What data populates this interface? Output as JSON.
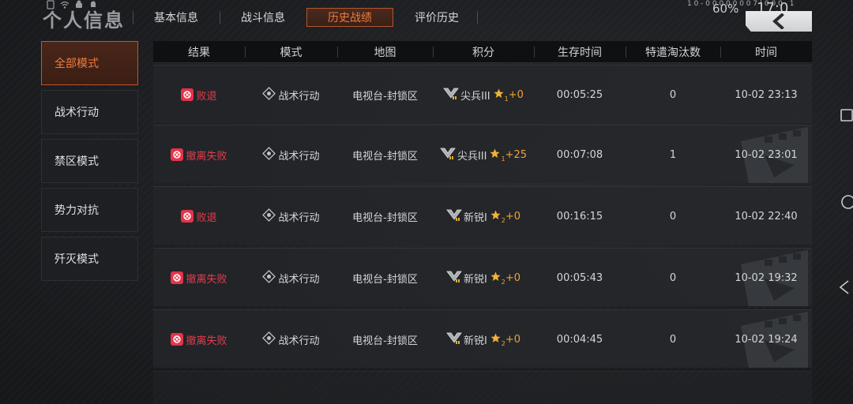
{
  "header": {
    "page_title": "个人信息",
    "tabs": [
      {
        "label": "基本信息",
        "active": false
      },
      {
        "label": "战斗信息",
        "active": false
      },
      {
        "label": "历史战绩",
        "active": true
      },
      {
        "label": "评价历史",
        "active": false
      }
    ],
    "status_text": "1 0 - 0 0 0 0 0 0 0 7 | 0 0 0 - 1",
    "battery": "60%",
    "clock": "17:0"
  },
  "sidebar": {
    "items": [
      {
        "label": "全部模式",
        "active": true
      },
      {
        "label": "战术行动",
        "active": false
      },
      {
        "label": "禁区模式",
        "active": false
      },
      {
        "label": "势力对抗",
        "active": false
      },
      {
        "label": "歼灭模式",
        "active": false
      }
    ]
  },
  "table": {
    "columns": [
      "结果",
      "模式",
      "地图",
      "积分",
      "生存时间",
      "特遣淘汰数",
      "时间"
    ],
    "rows": [
      {
        "result": "败退",
        "mode": "战术行动",
        "map": "电视台-封锁区",
        "rank": "尖兵III",
        "star_level": "1",
        "score_delta": "+0",
        "survival": "00:05:25",
        "eliminations": "0",
        "time": "10-02 23:13"
      },
      {
        "result": "撤离失败",
        "mode": "战术行动",
        "map": "电视台-封锁区",
        "rank": "尖兵III",
        "star_level": "1",
        "score_delta": "+25",
        "survival": "00:07:08",
        "eliminations": "1",
        "time": "10-02 23:01"
      },
      {
        "result": "败退",
        "mode": "战术行动",
        "map": "电视台-封锁区",
        "rank": "新锐I",
        "star_level": "2",
        "score_delta": "+0",
        "survival": "00:16:15",
        "eliminations": "0",
        "time": "10-02 22:40"
      },
      {
        "result": "撤离失败",
        "mode": "战术行动",
        "map": "电视台-封锁区",
        "rank": "新锐I",
        "star_level": "2",
        "score_delta": "+0",
        "survival": "00:05:43",
        "eliminations": "0",
        "time": "10-02 19:32"
      },
      {
        "result": "撤离失败",
        "mode": "战术行动",
        "map": "电视台-封锁区",
        "rank": "新锐I",
        "star_level": "2",
        "score_delta": "+0",
        "survival": "00:04:45",
        "eliminations": "0",
        "time": "10-02 19:24"
      }
    ]
  },
  "icons": {
    "result": "skull-badge-icon",
    "mode": "diamond-target-icon",
    "rank": "rank-chevron-icon",
    "star": "star-icon",
    "back": "chevron-left-icon"
  },
  "colors": {
    "accent": "#f07a3a",
    "lose": "#e43c4d",
    "score": "#f0a233",
    "background": "#1c1e21"
  }
}
